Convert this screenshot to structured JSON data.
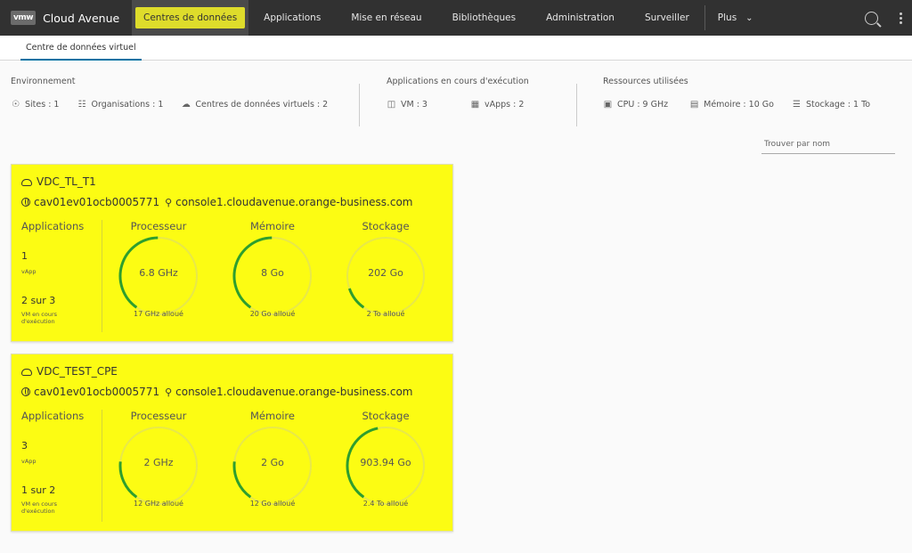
{
  "topnav": {
    "logo": "vmw",
    "app_title": "Cloud Avenue",
    "items": [
      {
        "label": "Centres de données",
        "active": true
      },
      {
        "label": "Applications"
      },
      {
        "label": "Mise en réseau"
      },
      {
        "label": "Bibliothèques"
      },
      {
        "label": "Administration"
      },
      {
        "label": "Surveiller"
      }
    ],
    "more_label": "Plus",
    "accent_color": "#dedc2b"
  },
  "subtabs": [
    {
      "label": "Centre de données virtuel"
    }
  ],
  "summary": {
    "environment": {
      "title": "Environnement",
      "sites": "Sites : 1",
      "organisations": "Organisations : 1",
      "vdcs": "Centres de données virtuels : 2"
    },
    "running": {
      "title": "Applications en cours d'exécution",
      "vm": "VM : 3",
      "vapps": "vApps : 2"
    },
    "resources": {
      "title": "Ressources utilisées",
      "cpu": "CPU : 9 GHz",
      "memory": "Mémoire : 10 Go",
      "storage": "Stockage : 1 To"
    }
  },
  "search": {
    "placeholder": "Trouver par nom"
  },
  "cards": [
    {
      "name": "VDC_TL_T1",
      "org": "cav01ev01ocb0005771",
      "site": "console1.cloudavenue.orange-business.com",
      "applications": {
        "head": "Applications",
        "vapp_count": "1",
        "vapp_label": "vApp",
        "vm_count": "2 sur 3",
        "vm_label": "VM en cours d'exécution"
      },
      "cpu": {
        "head": "Processeur",
        "value": "6.8 GHz",
        "alloc": "17 GHz alloué",
        "fraction": 0.4
      },
      "memory": {
        "head": "Mémoire",
        "value": "8 Go",
        "alloc": "20 Go alloué",
        "fraction": 0.4
      },
      "storage": {
        "head": "Stockage",
        "value": "202 Go",
        "alloc": "2 To alloué",
        "fraction": 0.1
      }
    },
    {
      "name": "VDC_TEST_CPE",
      "org": "cav01ev01ocb0005771",
      "site": "console1.cloudavenue.orange-business.com",
      "applications": {
        "head": "Applications",
        "vapp_count": "3",
        "vapp_label": "vApp",
        "vm_count": "1 sur 2",
        "vm_label": "VM en cours d'exécution"
      },
      "cpu": {
        "head": "Processeur",
        "value": "2 GHz",
        "alloc": "12 GHz alloué",
        "fraction": 0.17
      },
      "memory": {
        "head": "Mémoire",
        "value": "2 Go",
        "alloc": "12 Go alloué",
        "fraction": 0.17
      },
      "storage": {
        "head": "Stockage",
        "value": "903.94 Go",
        "alloc": "2.4 To alloué",
        "fraction": 0.37
      }
    }
  ],
  "colors": {
    "card_bg": "#fcfc13",
    "gauge_track": "#e8e84a",
    "gauge_fill": "#2e9e2e"
  }
}
